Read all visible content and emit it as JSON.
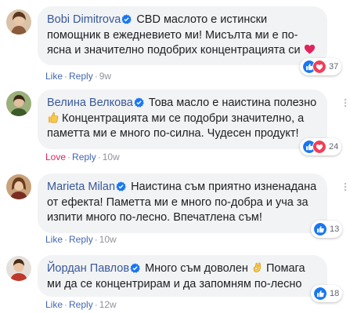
{
  "comments": [
    {
      "author": "Bobi Dimitrova",
      "text": "CBD маслото е истински помощник в ежедневието ми! Мисълта ми е по-ясна и значително подобрих концентрацията си",
      "emoji": "heart-icon",
      "reaction_count": "37",
      "reaction_types": [
        "like",
        "love"
      ],
      "action_label": "Like",
      "reply_label": "Reply",
      "time": "9w"
    },
    {
      "author": "Велина Велкова",
      "text": "Това масло е наистина полезно",
      "text2": "Концентрацията ми се подобри значително, а паметта ми е много по-силна. Чудесен продукт!",
      "emoji": "thumbs-up-icon",
      "reaction_count": "24",
      "reaction_types": [
        "like",
        "love"
      ],
      "action_label": "Love",
      "reply_label": "Reply",
      "time": "10w"
    },
    {
      "author": "Marieta Milan",
      "text": "Наистина съм приятно изненадана от ефекта! Паметта ми е много по-добра и уча за изпити много по-лесно. Впечатлена съм!",
      "reaction_count": "13",
      "reaction_types": [
        "like"
      ],
      "action_label": "Like",
      "reply_label": "Reply",
      "time": "10w"
    },
    {
      "author": "Йордан Павлов",
      "text": "Много съм доволен",
      "text2": "Помага ми да се концентрирам и да запомням по-лесно",
      "emoji": "ok-hand-icon",
      "reaction_count": "18",
      "reaction_types": [
        "like"
      ],
      "action_label": "Like",
      "reply_label": "Reply",
      "time": "12w"
    }
  ],
  "colors": {
    "author": "#385898",
    "bubble": "#f2f3f5",
    "link": "#4267b2",
    "love": "#e0245e",
    "like": "#1877f2"
  }
}
